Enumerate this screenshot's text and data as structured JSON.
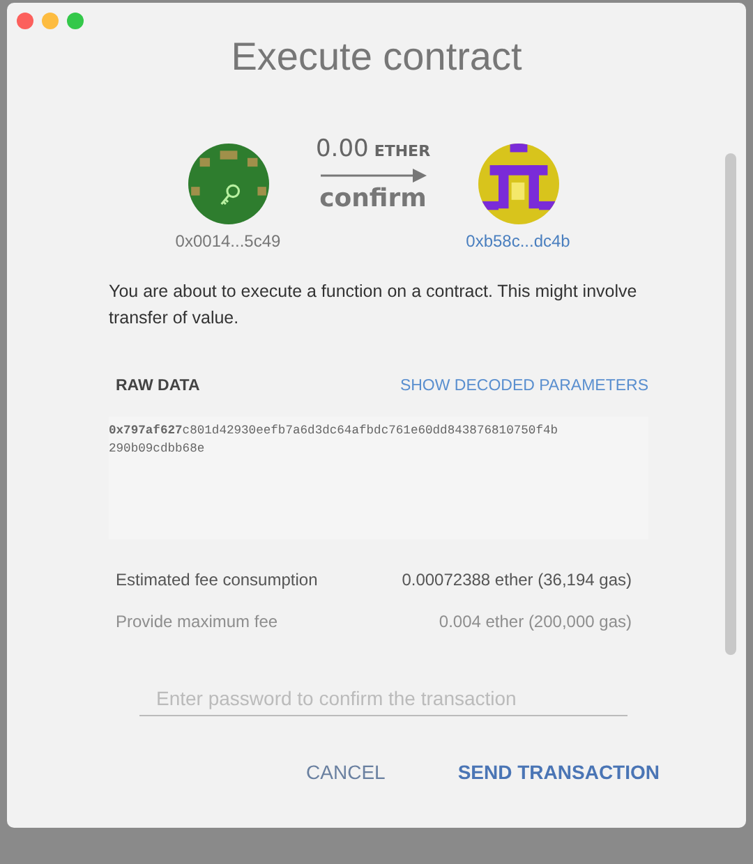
{
  "window": {
    "title": "Execute contract"
  },
  "transfer": {
    "from": "0x0014...5c49",
    "to": "0xb58c...dc4b",
    "amount": "0.00",
    "unit": "ETHER",
    "action": "confirm"
  },
  "message": "You are about to execute a function on a contract. This might involve transfer of value.",
  "raw_data": {
    "label": "RAW DATA",
    "toggle": "SHOW DECODED PARAMETERS",
    "data": "**0x797af627**c801d42930eefb7a6d3dc64afbdc761e60dd843876810750f4b 290b09cdbb68e"
  },
  "fees": [
    {
      "label": "Estimated fee consumption",
      "value": "0.00072388 ether (36,194 gas)",
      "faded": false
    },
    {
      "label": "Provide maximum fee",
      "value": "0.004 ether (200,000 gas)",
      "faded": true
    }
  ],
  "password": {
    "placeholder": "Enter password to confirm the transaction"
  },
  "buttons": [
    {
      "label": "CANCEL",
      "primary": false
    },
    {
      "label": "SEND TRANSACTION",
      "primary": true
    }
  ]
}
